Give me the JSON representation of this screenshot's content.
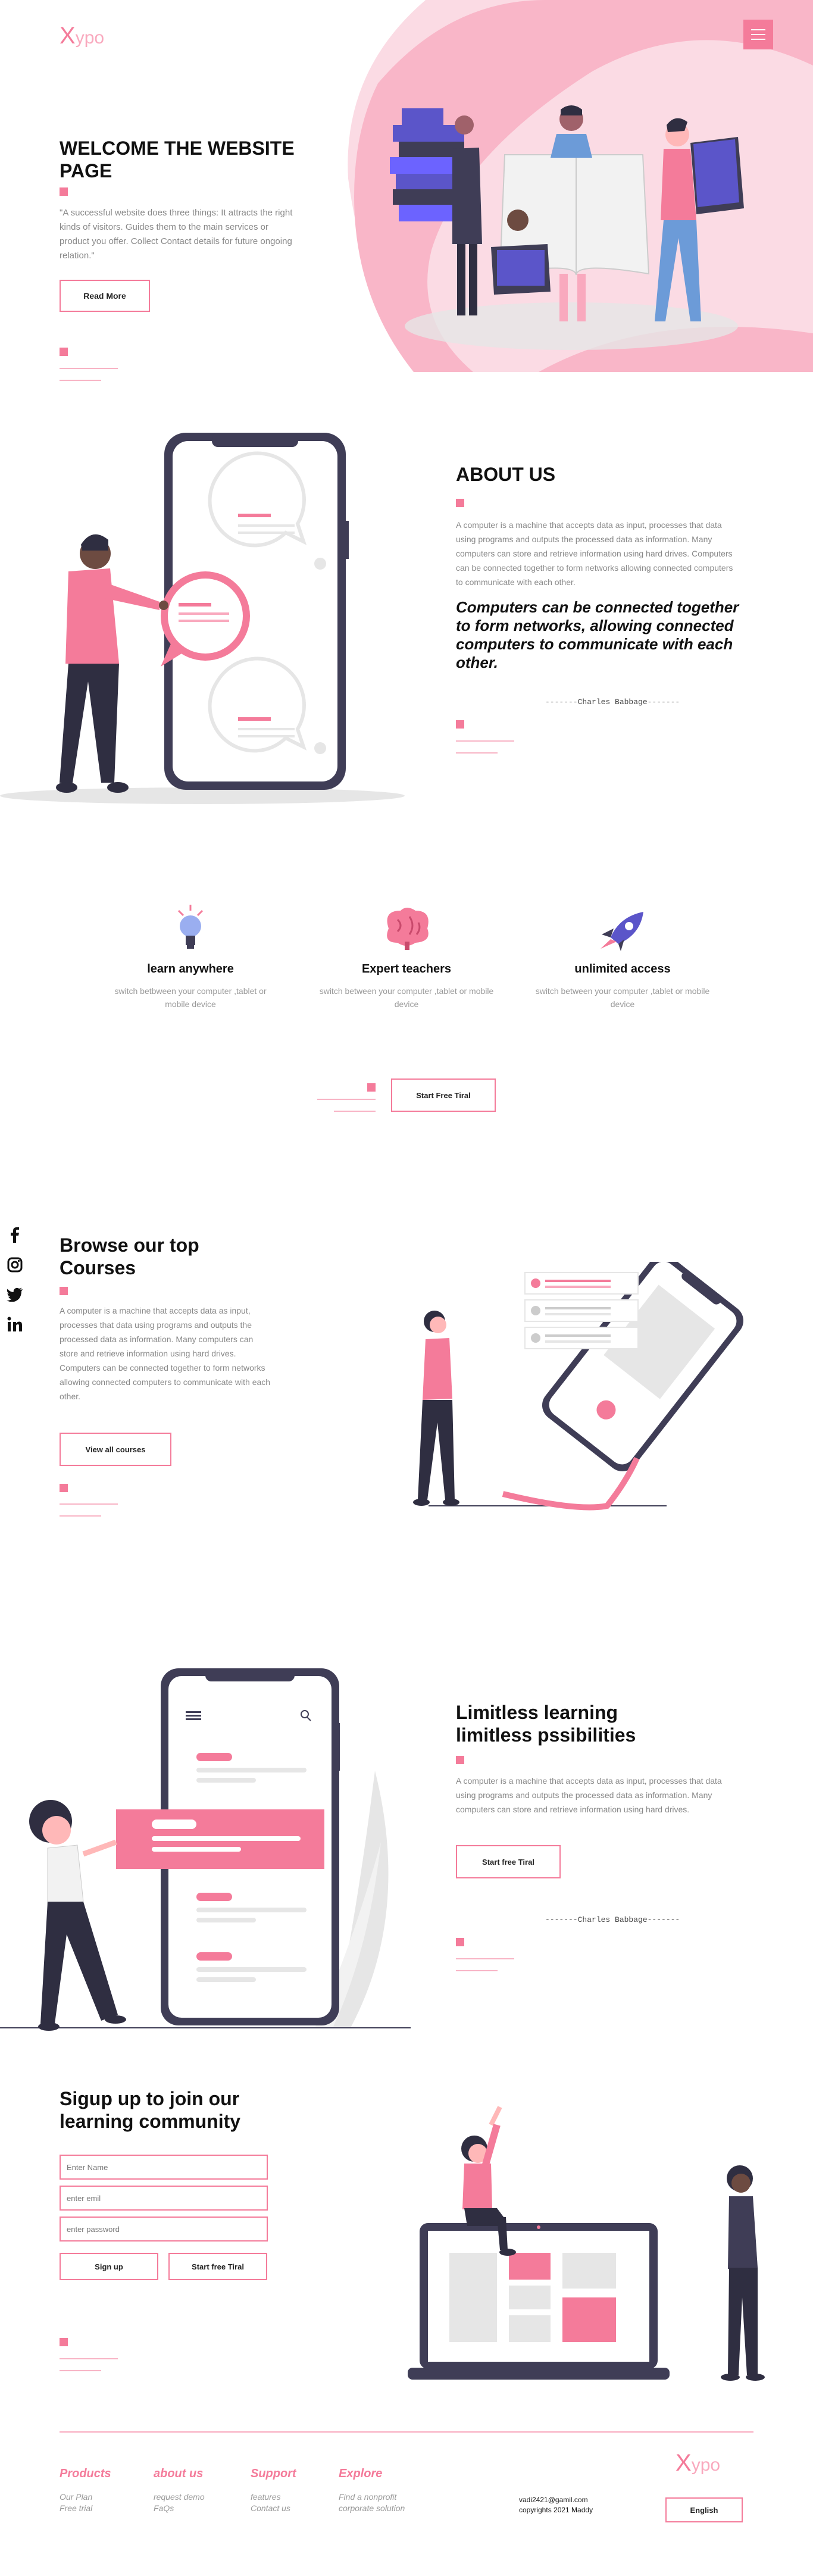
{
  "brand": {
    "x": "X",
    "name": "ypo"
  },
  "hero": {
    "title": "WELCOME THE WEBSITE PAGE",
    "quote": "\"A successful website does three things: It attracts the right kinds of visitors. Guides them to the main services or product you offer. Collect Contact details for future ongoing relation.\"",
    "button": "Read More"
  },
  "about": {
    "title": "ABOUT US",
    "body": "A computer is a machine that accepts data as input, processes that data using programs and outputs the processed data as information. Many computers can store and retrieve information using hard drives. Computers can be connected together to form networks allowing connected computers to communicate with each other.",
    "quote": "Computers can be connected together to form networks, allowing connected computers to communicate with each other.",
    "author": "-------Charles Babbage-------"
  },
  "features": [
    {
      "title": "learn anywhere",
      "desc": "switch betbween your computer ,tablet or mobile device",
      "icon": "lightbulb-icon"
    },
    {
      "title": "Expert teachers",
      "desc": "switch between your computer ,tablet or mobile device",
      "icon": "brain-icon"
    },
    {
      "title": "unlimited access",
      "desc": "switch between your computer ,tablet or mobile device",
      "icon": "rocket-icon"
    }
  ],
  "trial": {
    "button": "Start Free Tiral"
  },
  "social": [
    "facebook-icon",
    "instagram-icon",
    "twitter-icon",
    "linkedin-icon"
  ],
  "courses": {
    "title": "Browse our top Courses",
    "body": "A computer is a machine that accepts data as input, processes that data using programs and outputs the processed data as information. Many computers can store and retrieve information using hard drives. Computers can be connected together to form networks allowing connected computers to communicate with each other.",
    "button": "View all courses"
  },
  "limitless": {
    "title": "Limitless learning limitless pssibilities",
    "body": "A computer is a machine that accepts data as input, processes that data using programs and outputs the processed data as information. Many computers can store and retrieve information using hard drives.",
    "button": "Start free Tiral",
    "author": "-------Charles Babbage-------"
  },
  "signup": {
    "title": "Sigup up to join our learning community",
    "name_ph": "Enter Name",
    "email_ph": "enter emil",
    "password_ph": "enter password",
    "signup_btn": "Sign up",
    "trial_btn": "Start free Tiral"
  },
  "footer": {
    "cols": [
      {
        "title": "Products",
        "links": [
          "Our Plan",
          "Free trial"
        ]
      },
      {
        "title": "about us",
        "links": [
          "request demo",
          "FaQs"
        ]
      },
      {
        "title": "Support",
        "links": [
          "features",
          "Contact us"
        ]
      },
      {
        "title": "Explore",
        "links": [
          "Find a nonprofit",
          "corporate solution"
        ]
      }
    ],
    "email": "vadi2421@gamil.com",
    "copyright": "copyrights 2021 Maddy",
    "language": "English"
  },
  "colors": {
    "accent": "#f47b9a",
    "dark": "#3f3d56",
    "purple": "#5b55c9"
  }
}
